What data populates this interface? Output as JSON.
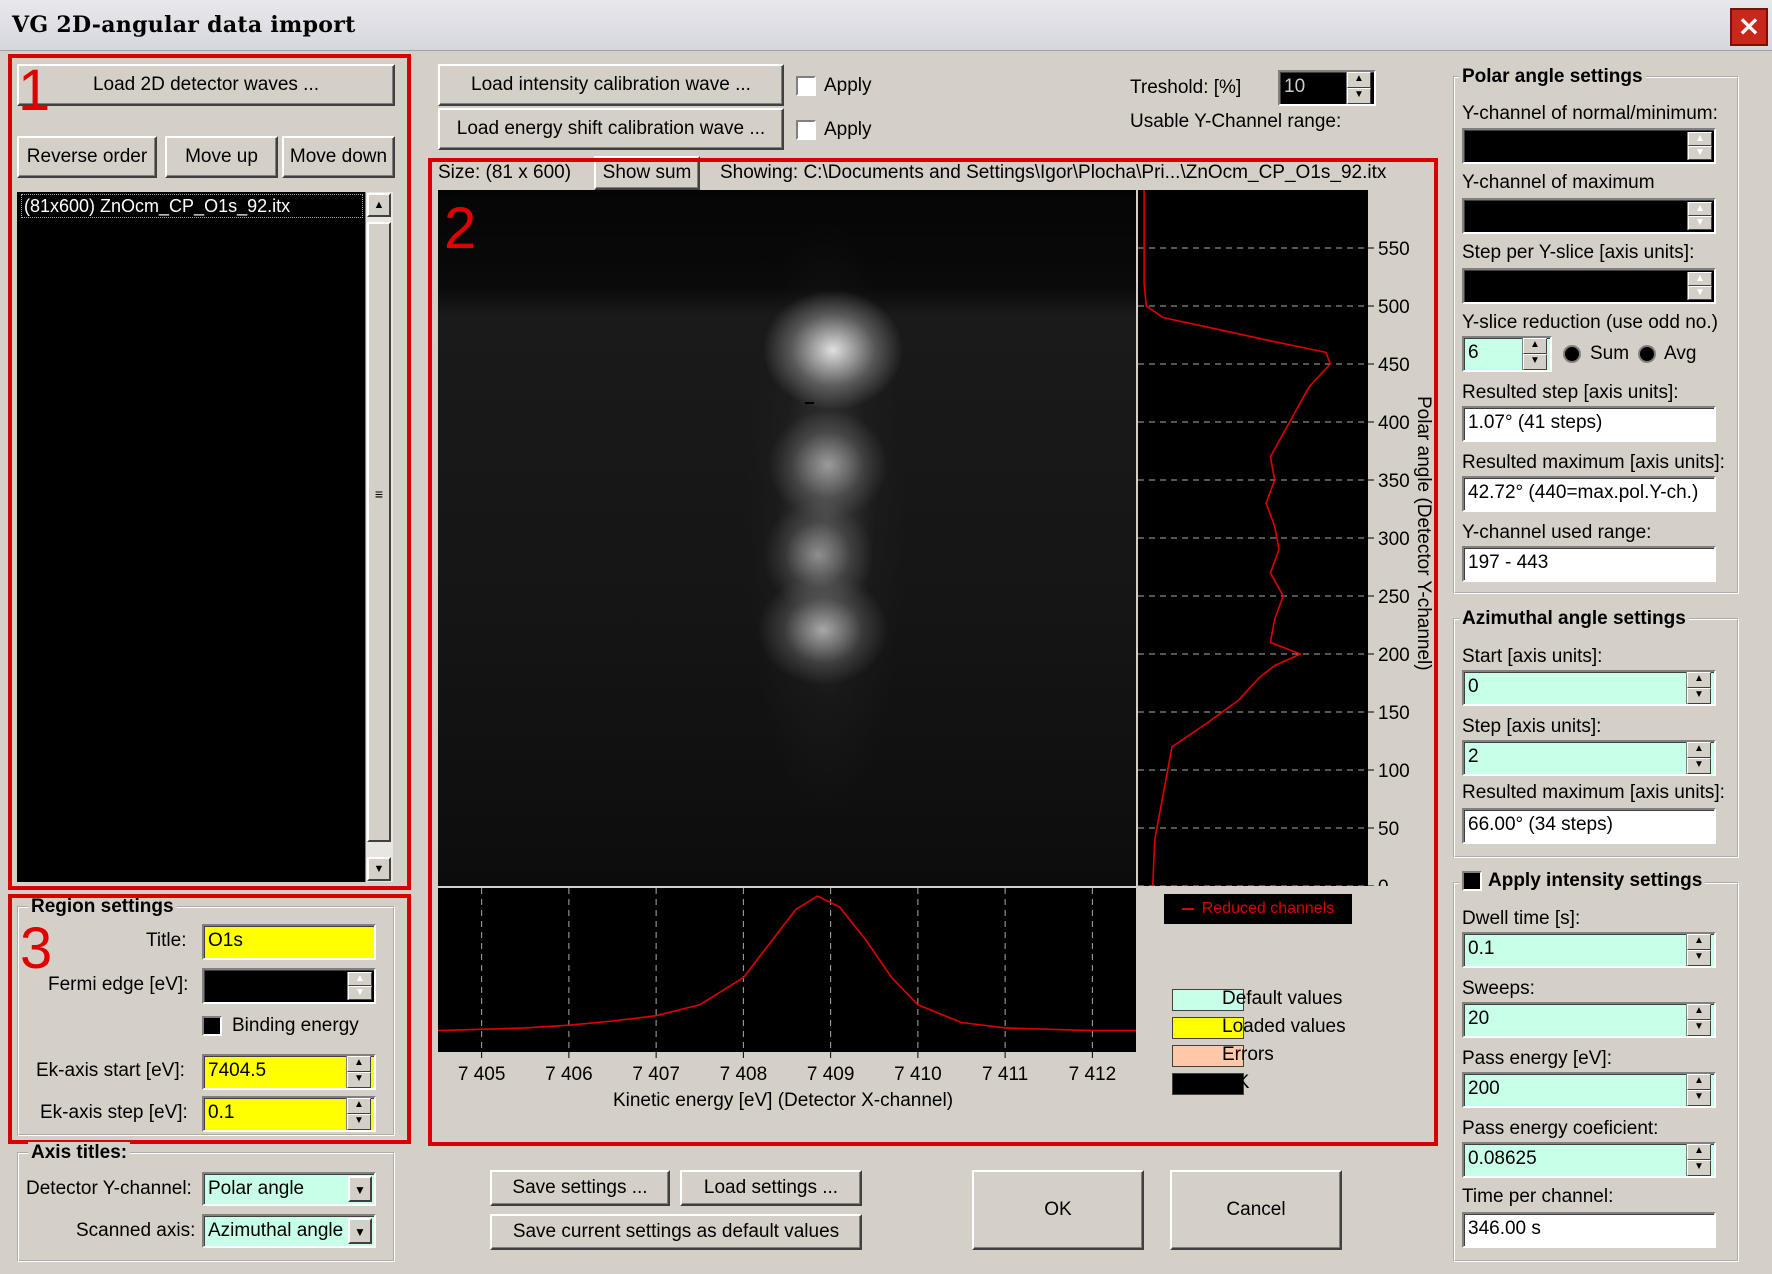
{
  "window": {
    "title": "VG 2D-angular data import",
    "close_icon": "×"
  },
  "annotations": {
    "n1": "1",
    "n2": "2",
    "n3": "3"
  },
  "files_panel": {
    "load_button": "Load 2D detector waves ...",
    "reverse_button": "Reverse order",
    "move_up_button": "Move up",
    "move_down_button": "Move down",
    "items": [
      "(81x600) ZnOcm_CP_O1s_92.itx"
    ]
  },
  "calibration": {
    "load_intensity_button": "Load intensity calibration wave ...",
    "load_energy_button": "Load energy shift calibration wave ...",
    "apply1": "Apply",
    "apply2": "Apply",
    "treshold_label": "Treshold: [%]",
    "treshold_value": "10",
    "usable_label": "Usable Y-Channel range:"
  },
  "viewer": {
    "size_label": "Size: (81 x 600)",
    "show_sum_button": "Show sum",
    "showing_label": "Showing: C:\\Documents and Settings\\Igor\\Plocha\\Pri...\\ZnOcm_CP_O1s_92.itx",
    "legend_reduced": "Reduced channels",
    "legend": {
      "default": "Default values",
      "loaded": "Loaded values",
      "errors": "Errors",
      "ok": "OK"
    },
    "colors": {
      "default": "#c8ffe8",
      "loaded": "#ffff00",
      "errors": "#ffc8a8",
      "ok": "#000000",
      "curve": "#e00000"
    }
  },
  "chart_data": [
    {
      "type": "line",
      "title": "",
      "xlabel": "Kinetic energy [eV] (Detector X-channel)",
      "ylabel": "",
      "x_ticks": [
        "7 405",
        "7 406",
        "7 407",
        "7 408",
        "7 409",
        "7 410",
        "7 411",
        "7 412"
      ],
      "xlim": [
        7404.5,
        7412.5
      ],
      "x": [
        7404.5,
        7405,
        7405.5,
        7406,
        7406.5,
        7407,
        7407.5,
        7408,
        7408.3,
        7408.6,
        7408.85,
        7409.1,
        7409.4,
        7409.7,
        7410,
        7410.5,
        7411,
        7411.5,
        7412,
        7412.5
      ],
      "y": [
        0.01,
        0.02,
        0.03,
        0.05,
        0.08,
        0.12,
        0.2,
        0.4,
        0.65,
        0.9,
        1.0,
        0.92,
        0.68,
        0.4,
        0.2,
        0.07,
        0.03,
        0.02,
        0.01,
        0.01
      ]
    },
    {
      "type": "line",
      "title": "",
      "ylabel": "Polar angle (Detector Y-channel)",
      "y_ticks": [
        "0",
        "50",
        "100",
        "150",
        "200",
        "250",
        "300",
        "350",
        "400",
        "450",
        "500",
        "550"
      ],
      "ylim": [
        0,
        600
      ],
      "series_name": "Reduced channels",
      "channel": [
        0,
        40,
        80,
        120,
        140,
        160,
        180,
        190,
        200,
        210,
        230,
        250,
        270,
        290,
        310,
        330,
        350,
        370,
        390,
        410,
        430,
        450,
        460,
        470,
        480,
        490,
        500,
        520,
        560,
        600
      ],
      "value": [
        0.05,
        0.06,
        0.1,
        0.14,
        0.3,
        0.45,
        0.55,
        0.62,
        0.74,
        0.6,
        0.62,
        0.66,
        0.6,
        0.64,
        0.62,
        0.58,
        0.62,
        0.6,
        0.66,
        0.72,
        0.78,
        0.88,
        0.86,
        0.6,
        0.35,
        0.1,
        0.02,
        0.01,
        0.01,
        0.01
      ]
    }
  ],
  "region": {
    "title": "Region settings",
    "title_label": "Title:",
    "title_value": "O1s",
    "fermi_label": "Fermi edge [eV]:",
    "binding_label": "Binding energy",
    "ek_start_label": "Ek-axis start [eV]:",
    "ek_start_value": "7404.5",
    "ek_step_label": "Ek-axis step [eV]:",
    "ek_step_value": "0.1"
  },
  "axis_titles": {
    "title": "Axis titles:",
    "det_label": "Detector Y-channel:",
    "det_value": "Polar angle",
    "scan_label": "Scanned axis:",
    "scan_value": "Azimuthal angle"
  },
  "bottom_buttons": {
    "save_settings": "Save settings ...",
    "load_settings": "Load settings ...",
    "save_default": "Save current settings as default values",
    "ok": "OK",
    "cancel": "Cancel"
  },
  "polar": {
    "title": "Polar angle settings",
    "ych_normal_label": "Y-channel of normal/minimum:",
    "ych_max_label": "Y-channel of maximum",
    "step_label": "Step per Y-slice [axis units]:",
    "reduction_label": "Y-slice reduction (use odd no.)",
    "reduction_value": "6",
    "sum_label": "Sum",
    "avg_label": "Avg",
    "res_step_label": "Resulted step [axis units]:",
    "res_step_value": "1.07°  (41 steps)",
    "res_max_label": "Resulted maximum [axis units]:",
    "res_max_value": "42.72°  (440=max.pol.Y-ch.)",
    "used_range_label": "Y-channel used range:",
    "used_range_value": "197  -  443"
  },
  "azimuthal": {
    "title": "Azimuthal angle settings",
    "start_label": "Start [axis units]:",
    "start_value": "0",
    "step_label": "Step [axis units]:",
    "step_value": "2",
    "res_max_label": "Resulted maximum [axis units]:",
    "res_max_value": "66.00°  (34 steps)"
  },
  "intensity": {
    "title": "Apply intensity settings",
    "dwell_label": "Dwell time [s]:",
    "dwell_value": "0.1",
    "sweeps_label": "Sweeps:",
    "sweeps_value": "20",
    "pass_label": "Pass energy [eV]:",
    "pass_value": "200",
    "coef_label": "Pass energy coeficient:",
    "coef_value": "0.08625",
    "time_label": "Time per channel:",
    "time_value": "346.00 s"
  }
}
